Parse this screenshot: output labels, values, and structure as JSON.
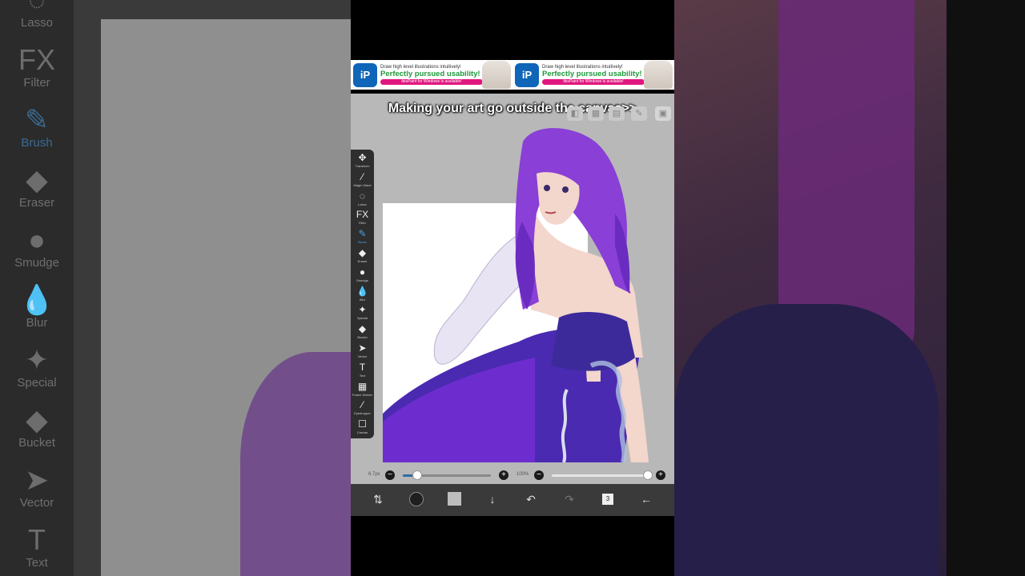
{
  "backdrop_tools": [
    {
      "label": "Lasso",
      "icon": "lasso-icon",
      "glyph": "◌"
    },
    {
      "label": "Filter",
      "icon": "fx-icon",
      "glyph": "FX"
    },
    {
      "label": "Brush",
      "icon": "brush-icon",
      "glyph": "✎"
    },
    {
      "label": "Eraser",
      "icon": "eraser-icon",
      "glyph": "◆"
    },
    {
      "label": "Smudge",
      "icon": "smudge-icon",
      "glyph": "●"
    },
    {
      "label": "Blur",
      "icon": "blur-icon",
      "glyph": "💧"
    },
    {
      "label": "Special",
      "icon": "special-icon",
      "glyph": "✦"
    },
    {
      "label": "Bucket",
      "icon": "bucket-icon",
      "glyph": "◆"
    },
    {
      "label": "Vector",
      "icon": "vector-icon",
      "glyph": "➤"
    },
    {
      "label": "Text",
      "icon": "text-icon",
      "glyph": "T"
    }
  ],
  "ad": {
    "logo": "iP",
    "line1": "Draw high level illustrations intuitively!",
    "line2": "Perfectly pursued usability!",
    "line3": "ibisPaint for Windows is available!"
  },
  "caption": "Making your art go outside the canvas>>",
  "toolbar": [
    {
      "label": "Transform",
      "icon": "transform-icon",
      "glyph": "✥"
    },
    {
      "label": "Magic Wand",
      "icon": "magic-wand-icon",
      "glyph": "⁄"
    },
    {
      "label": "Lasso",
      "icon": "lasso-icon",
      "glyph": "◌"
    },
    {
      "label": "Filter",
      "icon": "fx-icon",
      "glyph": "FX"
    },
    {
      "label": "Brush",
      "icon": "brush-icon",
      "glyph": "✎"
    },
    {
      "label": "Eraser",
      "icon": "eraser-icon",
      "glyph": "◆"
    },
    {
      "label": "Smudge",
      "icon": "smudge-icon",
      "glyph": "●"
    },
    {
      "label": "Blur",
      "icon": "blur-icon",
      "glyph": "💧"
    },
    {
      "label": "Special",
      "icon": "special-icon",
      "glyph": "✦"
    },
    {
      "label": "Bucket",
      "icon": "bucket-icon",
      "glyph": "◆"
    },
    {
      "label": "Vector",
      "icon": "vector-icon",
      "glyph": "➤"
    },
    {
      "label": "Text",
      "icon": "text-icon",
      "glyph": "T"
    },
    {
      "label": "Frame Divider",
      "icon": "frame-divider-icon",
      "glyph": "▦"
    },
    {
      "label": "Eyedropper",
      "icon": "eyedropper-icon",
      "glyph": "⁄"
    },
    {
      "label": "Canvas",
      "icon": "canvas-icon",
      "glyph": "☐"
    }
  ],
  "active_tool": "Brush",
  "brush_size": {
    "label": "6.7px",
    "fraction": 0.16
  },
  "opacity": {
    "label": "100%",
    "fraction": 1.0
  },
  "layers_count": "3",
  "colors": {
    "accent": "#4aa3e0",
    "hair": "#8a3fd6",
    "dress": "#4a2ab0",
    "skin": "#f3d6cc"
  }
}
